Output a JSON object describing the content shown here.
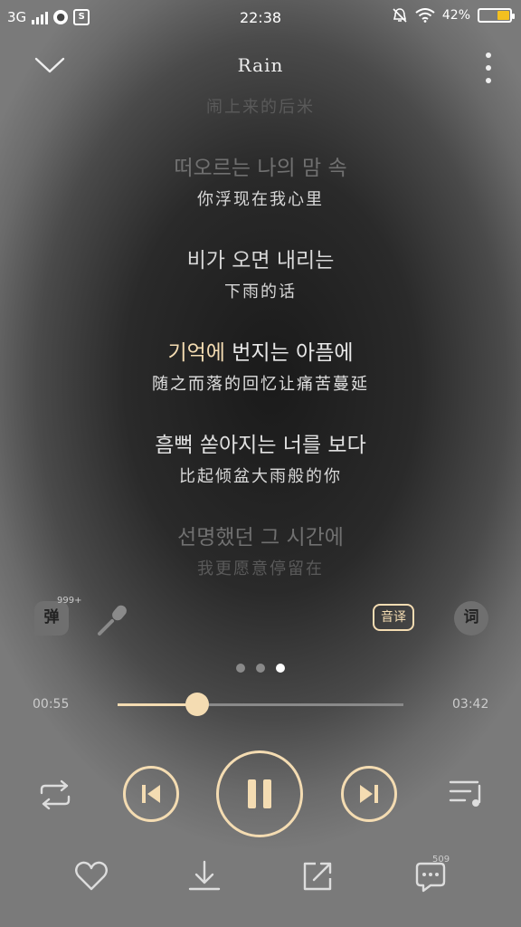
{
  "status_bar": {
    "network": "3G",
    "time": "22:38",
    "battery_percent": "42%",
    "battery_level": 0.42,
    "app_icon_s": "S"
  },
  "header": {
    "title": "Rain",
    "left_icon": "chevron-down-icon",
    "right_icon": "more-vert-icon"
  },
  "lyrics": [
    {
      "ko": "",
      "zh": "闹上来的后米"
    },
    {
      "ko": "떠오르는 나의 맘 속",
      "zh": "你浮现在我心里"
    },
    {
      "ko": "비가 오면 내리는",
      "zh": "下雨的话"
    },
    {
      "ko_highlighted": "기억에",
      "ko_rest": " 번지는 아픔에",
      "zh": "随之而落的回忆让痛苦蔓延"
    },
    {
      "ko": "흠뻑 쏟아지는 너를 보다",
      "zh": "比起倾盆大雨般的你"
    },
    {
      "ko": "선명했던 그 시간에",
      "zh": "我更愿意停留在"
    }
  ],
  "controls": {
    "danmu_label": "弹",
    "danmu_count": "999+",
    "translate_label": "音译",
    "lyrics_label": "词",
    "page_dots": 3,
    "active_dot": 3
  },
  "progress": {
    "current": "00:55",
    "total": "03:42",
    "fraction": 0.28
  },
  "playback": {
    "state": "playing",
    "repeat_icon": "repeat-icon",
    "prev_icon": "skip-previous-icon",
    "pause_icon": "pause-icon",
    "next_icon": "skip-next-icon",
    "playlist_icon": "playlist-icon"
  },
  "bottom_bar": {
    "comment_count": "509",
    "icons": [
      "heart-icon",
      "download-icon",
      "share-icon",
      "comment-icon"
    ]
  },
  "colors": {
    "accent": "#f4dcb2",
    "battery": "#f3c020"
  }
}
